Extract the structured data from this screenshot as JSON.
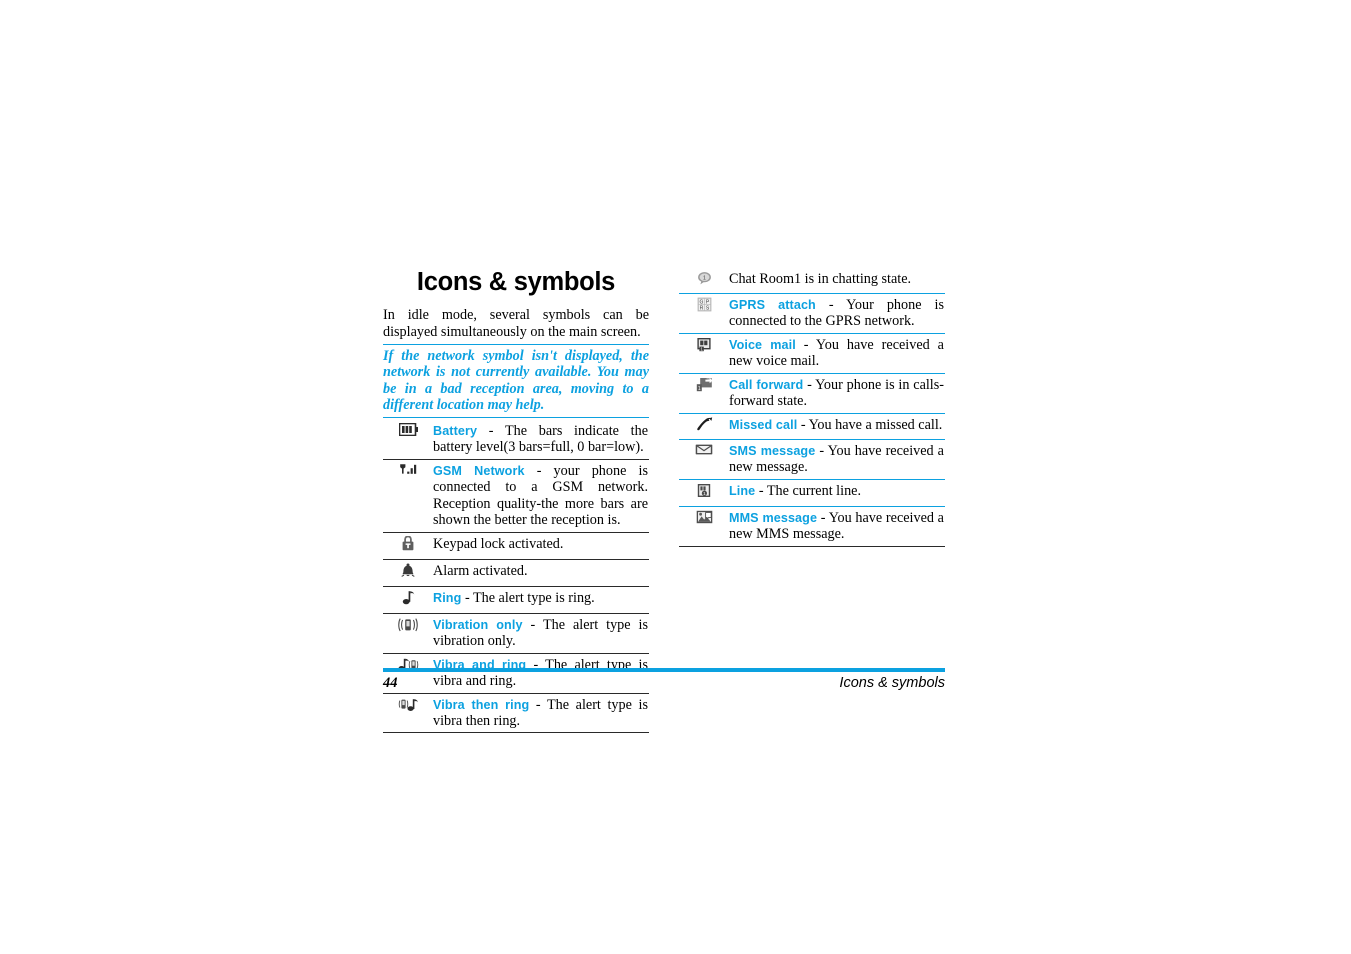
{
  "document": {
    "title": "Icons & symbols",
    "intro": "In idle mode, several symbols can be displayed simultaneously on the main screen.",
    "note": "If the network symbol isn't displayed, the network is not currently available. You may be in a bad reception area, moving to a different location may help.",
    "accent_color": "#0ca1e0",
    "rule_color": "#2a2a2a"
  },
  "left_column": {
    "rows": [
      {
        "icon": "battery-icon",
        "label": "Battery",
        "text": " - The bars indicate the battery level(3 bars=full, 0 bar=low)."
      },
      {
        "icon": "gsm-network-signal-icon",
        "label": "GSM Network",
        "text": " - your phone is connected to a GSM network. Reception quality-the more bars are shown the better the reception is."
      },
      {
        "icon": "keypad-lock-icon",
        "label": "",
        "text": "Keypad lock activated."
      },
      {
        "icon": "alarm-bell-icon",
        "label": "",
        "text": "Alarm activated."
      },
      {
        "icon": "ring-note-icon",
        "label": "Ring",
        "text": " - The alert type is ring."
      },
      {
        "icon": "vibration-only-icon",
        "label": "Vibration only",
        "text": " - The alert type is vibration only."
      },
      {
        "icon": "vibra-and-ring-icon",
        "label": "Vibra and ring",
        "text": " - The alert type is vibra and ring."
      },
      {
        "icon": "vibra-then-ring-icon",
        "label": "Vibra then ring",
        "text": " - The alert type is vibra then ring."
      }
    ]
  },
  "right_column": {
    "rows": [
      {
        "icon": "chat-room-icon",
        "label": "",
        "text": "Chat Room1 is in chatting state."
      },
      {
        "icon": "gprs-attach-icon",
        "label": "GPRS attach",
        "text": " - Your phone is connected to the GPRS network."
      },
      {
        "icon": "voice-mail-icon",
        "label": "Voice mail",
        "text": " - You have received a new voice mail."
      },
      {
        "icon": "call-forward-icon",
        "label": "Call forward",
        "text": " - Your phone is in calls-forward state."
      },
      {
        "icon": "missed-call-icon",
        "label": "Missed call",
        "text": " - You have a missed call."
      },
      {
        "icon": "sms-message-icon",
        "label": "SMS message",
        "text": " - You have received a new message."
      },
      {
        "icon": "line-icon",
        "label": "Line",
        "text": " - The current line."
      },
      {
        "icon": "mms-message-icon",
        "label": "MMS message",
        "text": " - You have received a new MMS message."
      }
    ]
  },
  "footer": {
    "page_number": "44",
    "section": "Icons & symbols"
  }
}
